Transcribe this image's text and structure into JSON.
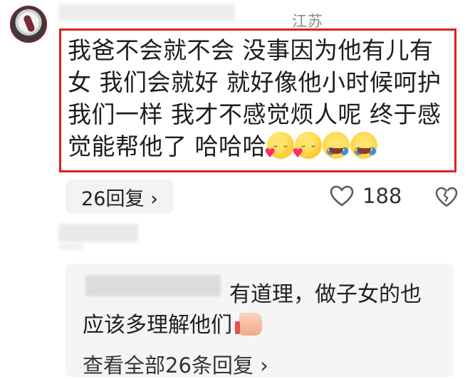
{
  "comment": {
    "location": "江苏",
    "text": "我爸不会就不会 没事因为他有儿有女 我们会就好 就好像他小时候呵护我们一样 我才不感觉烦人呢 终于感觉能帮他了 哈哈哈",
    "emojis": [
      "kiss-emoji",
      "kiss-emoji",
      "cry-laugh-emoji",
      "cry-laugh-emoji"
    ],
    "reply_count_label": "26回复 ›",
    "likes": "188"
  },
  "reply": {
    "text_line1": "有道理，做子女的也",
    "text_line2": "应该多理解他们",
    "view_all": "查看全部26条回复 ›"
  }
}
